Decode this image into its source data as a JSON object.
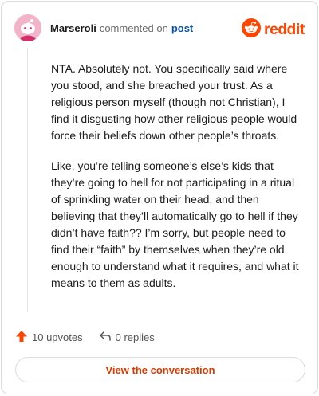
{
  "header": {
    "username": "Marseroli",
    "action_text": "commented on",
    "post_link": "post",
    "brand": "reddit",
    "brand_color": "#ff4500",
    "avatar_icon": "snoo-avatar-icon",
    "brand_icon": "reddit-alien-icon"
  },
  "comment": {
    "paragraphs": [
      "NTA. Absolutely not. You specifically said where you stood, and she breached your trust. As a religious person myself (though not Christian), I find it disgusting how other religious people would force their beliefs down other people’s throats.",
      "Like, you’re telling someone’s else’s kids that they’re going to hell for not participating in a ritual of sprinkling water on their head, and then believing that they’ll automatically go to hell if they didn’t have faith?? I’m sorry, but people need to find their “faith” by themselves when they’re old enough to understand what it requires, and what it means to them as adults."
    ]
  },
  "actions": {
    "upvotes": "10 upvotes",
    "replies": "0 replies",
    "upvote_icon": "upvote-arrow-icon",
    "reply_icon": "reply-arrow-icon"
  },
  "button": {
    "label": "View the conversation"
  }
}
